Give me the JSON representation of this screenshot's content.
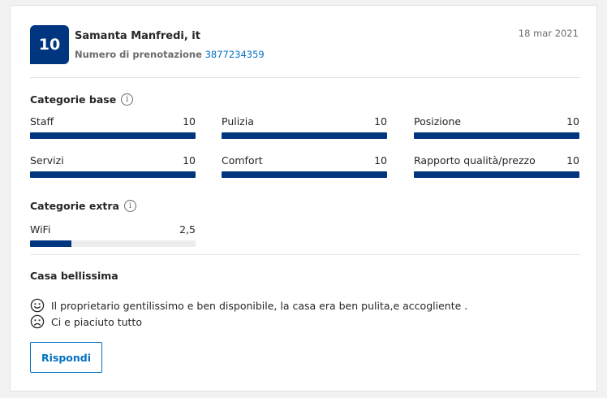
{
  "review": {
    "score": "10",
    "reviewer_name": "Samanta Manfredi, it",
    "booking_label": "Numero di prenotazione",
    "booking_number": "3877234359",
    "date": "18 mar 2021",
    "title": "Casa bellissima",
    "positive_comment": "Il proprietario gentilissimo e ben disponibile, la casa era ben pulita,e accogliente .",
    "negative_comment": "Ci e piaciuto tutto",
    "positive_icon": "smile-face-icon",
    "negative_icon": "sad-face-icon",
    "reply_label": "Rispondi"
  },
  "base_categories": {
    "title": "Categorie base",
    "info_icon": "info-icon",
    "items": [
      {
        "label": "Staff",
        "score": "10",
        "fraction": 1.0
      },
      {
        "label": "Pulizia",
        "score": "10",
        "fraction": 1.0
      },
      {
        "label": "Posizione",
        "score": "10",
        "fraction": 1.0
      },
      {
        "label": "Servizi",
        "score": "10",
        "fraction": 1.0
      },
      {
        "label": "Comfort",
        "score": "10",
        "fraction": 1.0
      },
      {
        "label": "Rapporto qualità/prezzo",
        "score": "10",
        "fraction": 1.0
      }
    ]
  },
  "extra_categories": {
    "title": "Categorie extra",
    "info_icon": "info-icon",
    "items": [
      {
        "label": "WiFi",
        "score": "2,5",
        "fraction": 0.25
      }
    ]
  },
  "colors": {
    "badge": "#003580",
    "bar_fill": "#003580",
    "bar_track": "#ededed",
    "link": "#0071c2"
  }
}
